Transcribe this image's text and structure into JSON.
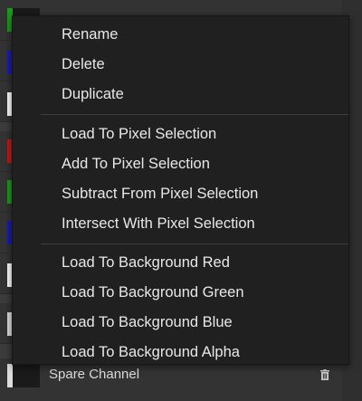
{
  "channels_panel": {
    "rows": [
      {
        "swatch_color": "#1a9a1a"
      },
      {
        "swatch_color": "#1a1ab0"
      },
      {
        "swatch_color": "#ffffff"
      },
      {
        "swatch_color": "#c01818"
      },
      {
        "swatch_color": "#1a9a1a"
      },
      {
        "swatch_color": "#1a1ab0"
      },
      {
        "swatch_color": "#ffffff"
      },
      {
        "swatch_color": "#dcdcdc"
      },
      {
        "swatch_color": "#dcdcdc"
      }
    ],
    "spare_channel_label": "Spare Channel"
  },
  "context_menu": {
    "group_1": {
      "rename": "Rename",
      "delete": "Delete",
      "duplicate": "Duplicate"
    },
    "group_2": {
      "load_to_pixel_selection": "Load To Pixel Selection",
      "add_to_pixel_selection": "Add To Pixel Selection",
      "subtract_from_pixel_selection": "Subtract From Pixel Selection",
      "intersect_with_pixel_selection": "Intersect With Pixel Selection"
    },
    "group_3": {
      "load_to_background_red": "Load To Background Red",
      "load_to_background_green": "Load To Background Green",
      "load_to_background_blue": "Load To Background Blue",
      "load_to_background_alpha": "Load To Background Alpha"
    }
  },
  "colors": {
    "menu_background": "#202020",
    "menu_text": "#e8e8e8",
    "separator": "#3d3d3d"
  }
}
